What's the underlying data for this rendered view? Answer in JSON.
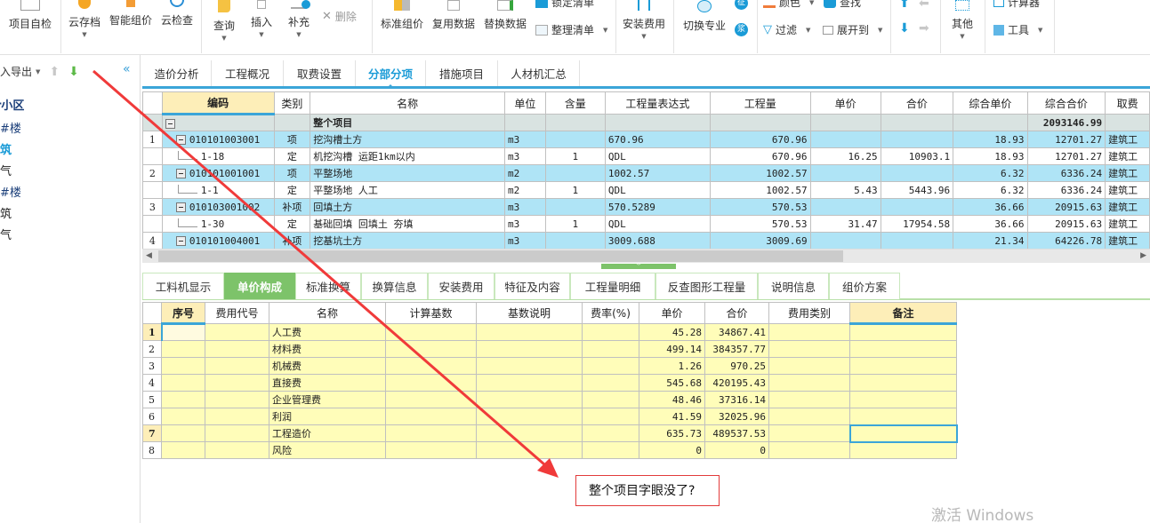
{
  "toolbar": {
    "buttons": [
      {
        "label": "项目自检"
      },
      {
        "label": "云存档"
      },
      {
        "label": "智能组价"
      },
      {
        "label": "云检查"
      },
      {
        "label": "查询"
      },
      {
        "label": "插入"
      },
      {
        "label": "补充"
      },
      {
        "label": "删除"
      },
      {
        "label": "标准组价"
      },
      {
        "label": "复用数据"
      },
      {
        "label": "替换数据"
      },
      {
        "label": "锁定清单"
      },
      {
        "label": "整理清单"
      },
      {
        "label": "安装费用"
      },
      {
        "label": "切换专业"
      },
      {
        "label": "颜色"
      },
      {
        "label": "查找"
      },
      {
        "label": "过滤"
      },
      {
        "label": "展开到"
      },
      {
        "label": "其他"
      },
      {
        "label": "计算器"
      },
      {
        "label": "工具"
      }
    ],
    "badges": {
      "zheng": "征",
      "jiang": "浆"
    }
  },
  "left_panel": {
    "import_export": "导入导出",
    "collapse": "«",
    "items": [
      {
        "label": "小区",
        "style": "header"
      },
      {
        "label": "#楼"
      },
      {
        "label": "筑",
        "style": "active"
      },
      {
        "label": "气"
      },
      {
        "label": "#楼"
      },
      {
        "label": "筑"
      },
      {
        "label": "气"
      }
    ]
  },
  "main_tabs": [
    {
      "label": "造价分析"
    },
    {
      "label": "工程概况"
    },
    {
      "label": "取费设置"
    },
    {
      "label": "分部分项",
      "active": true
    },
    {
      "label": "措施项目"
    },
    {
      "label": "人材机汇总"
    }
  ],
  "upper_grid": {
    "columns": [
      "编码",
      "类别",
      "名称",
      "单位",
      "含量",
      "工程量表达式",
      "工程量",
      "单价",
      "合价",
      "综合单价",
      "综合合价",
      "取费"
    ],
    "total_row": {
      "name": "整个项目",
      "total": "2093146.99"
    },
    "rows": [
      {
        "no": "1",
        "type": "xiang",
        "code": "010101003001",
        "cat": "项",
        "name": "挖沟槽土方",
        "unit": "m3",
        "qty_ratio": "",
        "expr": "670.96",
        "qty": "670.96",
        "price": "",
        "amount": "",
        "unit_total": "18.93",
        "total": "12701.27",
        "fee": "建筑工"
      },
      {
        "no": "",
        "type": "ding",
        "code": "1-18",
        "cat": "定",
        "name": "机挖沟槽 运距1km以内",
        "unit": "m3",
        "qty_ratio": "1",
        "expr": "QDL",
        "qty": "670.96",
        "price": "16.25",
        "amount": "10903.1",
        "unit_total": "18.93",
        "total": "12701.27",
        "fee": "建筑工"
      },
      {
        "no": "2",
        "type": "xiang",
        "code": "010101001001",
        "cat": "项",
        "name": "平整场地",
        "unit": "m2",
        "qty_ratio": "",
        "expr": "1002.57",
        "qty": "1002.57",
        "price": "",
        "amount": "",
        "unit_total": "6.32",
        "total": "6336.24",
        "fee": "建筑工"
      },
      {
        "no": "",
        "type": "ding",
        "code": "1-1",
        "cat": "定",
        "name": "平整场地 人工",
        "unit": "m2",
        "qty_ratio": "1",
        "expr": "QDL",
        "qty": "1002.57",
        "price": "5.43",
        "amount": "5443.96",
        "unit_total": "6.32",
        "total": "6336.24",
        "fee": "建筑工"
      },
      {
        "no": "3",
        "type": "xiang",
        "code": "010103001002",
        "cat": "补项",
        "name": "回填土方",
        "unit": "m3",
        "qty_ratio": "",
        "expr": "570.5289",
        "qty": "570.53",
        "price": "",
        "amount": "",
        "unit_total": "36.66",
        "total": "20915.63",
        "fee": "建筑工"
      },
      {
        "no": "",
        "type": "ding",
        "code": "1-30",
        "cat": "定",
        "name": "基础回填 回填土 夯填",
        "unit": "m3",
        "qty_ratio": "1",
        "expr": "QDL",
        "qty": "570.53",
        "price": "31.47",
        "amount": "17954.58",
        "unit_total": "36.66",
        "total": "20915.63",
        "fee": "建筑工"
      },
      {
        "no": "4",
        "type": "xiang",
        "code": "010101004001",
        "cat": "补项",
        "name": "挖基坑土方",
        "unit": "m3",
        "qty_ratio": "",
        "expr": "3009.688",
        "qty": "3009.69",
        "price": "",
        "amount": "",
        "unit_total": "21.34",
        "total": "64226.78",
        "fee": "建筑工"
      }
    ]
  },
  "lower_tabs": [
    {
      "label": "工料机显示"
    },
    {
      "label": "单价构成",
      "active": true
    },
    {
      "label": "标准换算"
    },
    {
      "label": "换算信息"
    },
    {
      "label": "安装费用"
    },
    {
      "label": "特征及内容"
    },
    {
      "label": "工程量明细"
    },
    {
      "label": "反查图形工程量"
    },
    {
      "label": "说明信息"
    },
    {
      "label": "组价方案"
    }
  ],
  "lower_grid": {
    "columns": [
      "序号",
      "费用代号",
      "名称",
      "计算基数",
      "基数说明",
      "费率(%)",
      "单价",
      "合价",
      "费用类别",
      "备注"
    ],
    "rows": [
      {
        "no": "1",
        "seq": "",
        "code": "",
        "name": "人工费",
        "base": "",
        "base_desc": "",
        "rate": "",
        "price": "45.28",
        "amount": "34867.41",
        "cat": "",
        "note": ""
      },
      {
        "no": "2",
        "seq": "",
        "code": "",
        "name": "材料费",
        "base": "",
        "base_desc": "",
        "rate": "",
        "price": "499.14",
        "amount": "384357.77",
        "cat": "",
        "note": ""
      },
      {
        "no": "3",
        "seq": "",
        "code": "",
        "name": "机械费",
        "base": "",
        "base_desc": "",
        "rate": "",
        "price": "1.26",
        "amount": "970.25",
        "cat": "",
        "note": ""
      },
      {
        "no": "4",
        "seq": "",
        "code": "",
        "name": "直接费",
        "base": "",
        "base_desc": "",
        "rate": "",
        "price": "545.68",
        "amount": "420195.43",
        "cat": "",
        "note": ""
      },
      {
        "no": "5",
        "seq": "",
        "code": "",
        "name": "企业管理费",
        "base": "",
        "base_desc": "",
        "rate": "",
        "price": "48.46",
        "amount": "37316.14",
        "cat": "",
        "note": ""
      },
      {
        "no": "6",
        "seq": "",
        "code": "",
        "name": "利润",
        "base": "",
        "base_desc": "",
        "rate": "",
        "price": "41.59",
        "amount": "32025.96",
        "cat": "",
        "note": ""
      },
      {
        "no": "7",
        "seq": "",
        "code": "",
        "name": "工程造价",
        "base": "",
        "base_desc": "",
        "rate": "",
        "price": "635.73",
        "amount": "489537.53",
        "cat": "",
        "note": ""
      },
      {
        "no": "8",
        "seq": "",
        "code": "",
        "name": "风险",
        "base": "",
        "base_desc": "",
        "rate": "",
        "price": "0",
        "amount": "0",
        "cat": "",
        "note": ""
      }
    ]
  },
  "annotation": {
    "text": "整个项目字眼没了?",
    "color": "#e23b3b"
  },
  "watermark": "激活 Windows",
  "colors": {
    "accent_blue": "#3ba5d8",
    "row_blue": "#afe4f6",
    "tab_green": "#7dc36a",
    "cell_yellow": "#fffdb9",
    "header_yellow": "#fdeeb8"
  }
}
